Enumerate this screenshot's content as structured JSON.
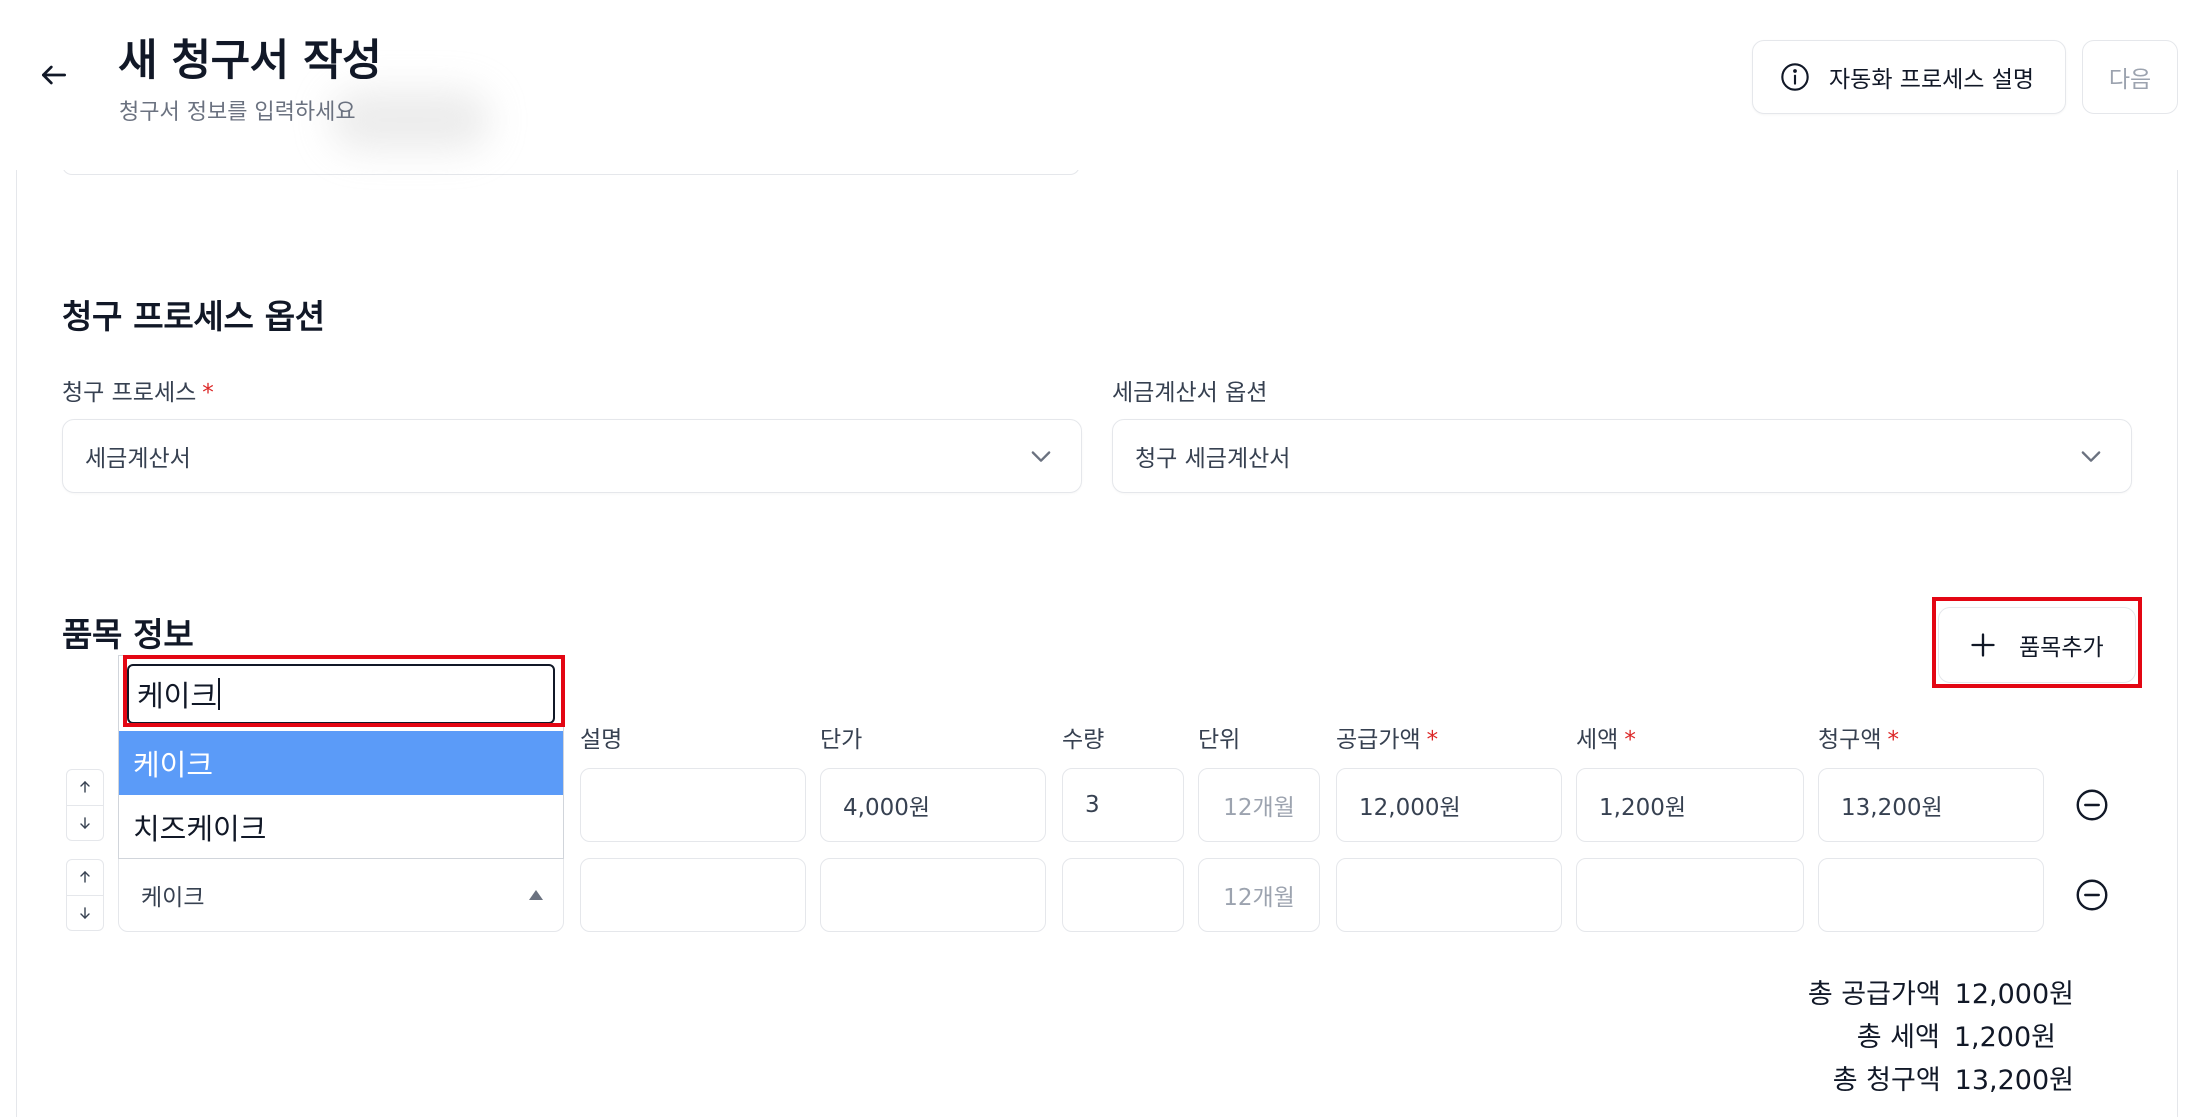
{
  "header": {
    "title": "새 청구서 작성",
    "subtitle": "청구서 정보를 입력하세요",
    "help_label": "자동화 프로세스 설명",
    "next_label": "다음"
  },
  "billing_section": {
    "title": "청구 프로세스 옵션",
    "process_label": "청구 프로세스",
    "process_value": "세금계산서",
    "tax_option_label": "세금계산서 옵션",
    "tax_option_value": "청구 세금계산서"
  },
  "items_section": {
    "title": "품목 정보",
    "add_item_label": "품목추가",
    "columns": {
      "description": "설명",
      "unit_price": "단가",
      "quantity": "수량",
      "unit": "단위",
      "supply_amount": "공급가액",
      "tax": "세액",
      "billing_amount": "청구액"
    },
    "rows": [
      {
        "item": "",
        "description": "",
        "unit_price": "4,000원",
        "quantity": "3",
        "unit": "12개월",
        "supply_amount": "12,000원",
        "tax": "1,200원",
        "billing_amount": "13,200원"
      },
      {
        "item": "케이크",
        "description": "",
        "unit_price": "",
        "quantity": "",
        "unit": "12개월",
        "supply_amount": "",
        "tax": "",
        "billing_amount": ""
      }
    ]
  },
  "dropdown": {
    "search_value": "케이크",
    "options": [
      "케이크",
      "치즈케이크"
    ],
    "selected_index": 0
  },
  "totals": {
    "supply_label": "총 공급가액",
    "supply_value": "12,000원",
    "tax_label": "총 세액",
    "tax_value": "1,200원",
    "billing_label": "총 청구액",
    "billing_value": "13,200원"
  },
  "colors": {
    "required": "#dc2626",
    "highlight": "#e30613",
    "selected_option": "#5b9bf8"
  },
  "icons": {
    "back": "arrow-left-icon",
    "help": "info-circle-icon",
    "chevron": "chevron-down-icon",
    "add": "plus-icon",
    "remove": "minus-circle-icon",
    "move_up": "arrow-up-icon",
    "move_down": "arrow-down-icon"
  }
}
